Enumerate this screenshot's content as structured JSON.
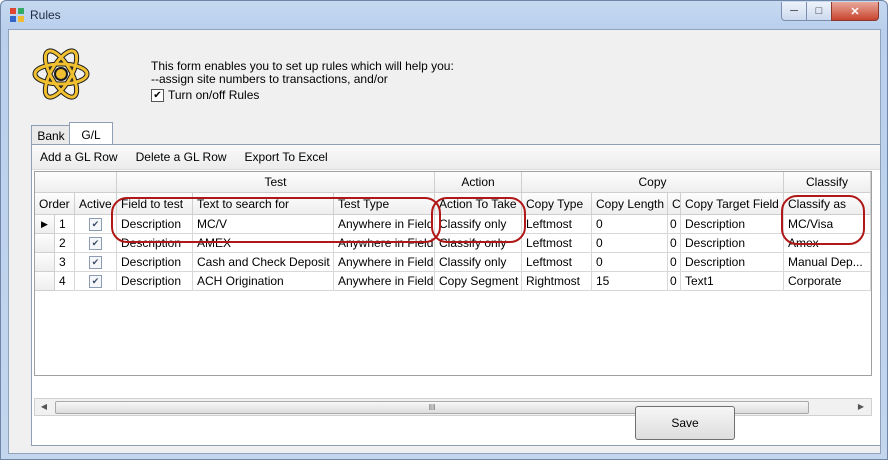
{
  "window": {
    "title": "Rules"
  },
  "info": {
    "line1": "This form enables you to set up rules which will help you:",
    "line2": "--assign site numbers to transactions, and/or",
    "toggle_label": "Turn on/off Rules",
    "toggle_checked": true
  },
  "tabs": [
    {
      "label": "Bank",
      "active": false
    },
    {
      "label": "G/L",
      "active": true
    }
  ],
  "toolbar": {
    "add": "Add a GL Row",
    "delete": "Delete a GL Row",
    "export": "Export To Excel"
  },
  "grid": {
    "groups": [
      "Test",
      "Action",
      "Copy",
      "Classify"
    ],
    "columns": [
      "Order",
      "Active",
      "Field to test",
      "Text to search for",
      "Test Type",
      "Action To Take",
      "Copy Type",
      "Copy Length",
      "C",
      "Copy Target Field",
      "Classify as"
    ],
    "rows": [
      {
        "order": "1",
        "active": true,
        "field": "Description",
        "text": "MC/V",
        "test_type": "Anywhere in Field",
        "action": "Classify only",
        "copy_type": "Leftmost",
        "copy_length": "0",
        "c": "0",
        "target": "Description",
        "classify": "MC/Visa",
        "current": true
      },
      {
        "order": "2",
        "active": true,
        "field": "Description",
        "text": "AMEX",
        "test_type": "Anywhere in Field",
        "action": "Classify only",
        "copy_type": "Leftmost",
        "copy_length": "0",
        "c": "0",
        "target": "Description",
        "classify": "Amex",
        "current": false
      },
      {
        "order": "3",
        "active": true,
        "field": "Description",
        "text": "Cash and Check Deposit",
        "test_type": "Anywhere in Field",
        "action": "Classify only",
        "copy_type": "Leftmost",
        "copy_length": "0",
        "c": "0",
        "target": "Description",
        "classify": "Manual Dep...",
        "current": false
      },
      {
        "order": "4",
        "active": true,
        "field": "Description",
        "text": "ACH Origination",
        "test_type": "Anywhere in Field",
        "action": "Copy Segment",
        "copy_type": "Rightmost",
        "copy_length": "15",
        "c": "0",
        "target": "Text1",
        "classify": "Corporate",
        "current": false
      }
    ]
  },
  "save_label": "Save",
  "colors": {
    "highlight": "#b01818",
    "titlebar": "#c6d9f1"
  }
}
